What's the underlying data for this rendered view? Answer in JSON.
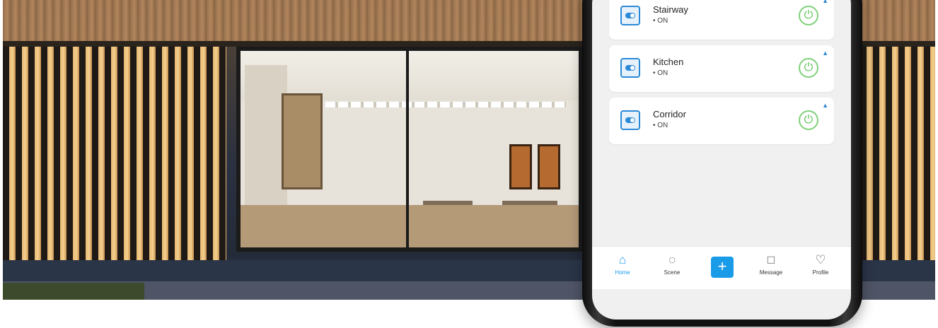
{
  "devices": [
    {
      "name": "Stairway",
      "status": "• ON",
      "icon": "switch-icon"
    },
    {
      "name": "Kitchen",
      "status": "• ON",
      "icon": "switch-icon"
    },
    {
      "name": "Corridor",
      "status": "• ON",
      "icon": "switch-icon"
    }
  ],
  "tabbar": {
    "home": "Home",
    "scene": "Scene",
    "add": "+",
    "message": "Message",
    "profile": "Profile"
  },
  "colors": {
    "accent": "#1a9be8",
    "power_on": "#5cc457",
    "screen_bg": "#f0f0f0"
  }
}
